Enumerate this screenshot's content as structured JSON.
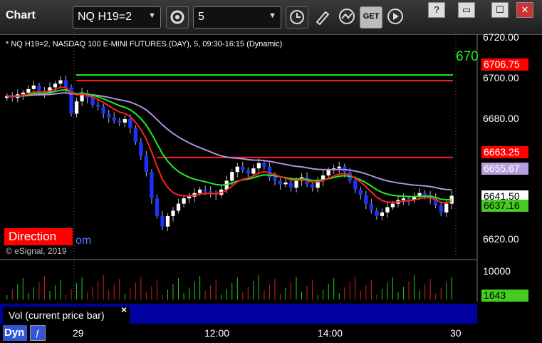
{
  "window": {
    "title": "Chart",
    "min": "?",
    "restore": "▭",
    "max": "☐",
    "close": "✕"
  },
  "toolbar": {
    "symbol": "NQ H19=2",
    "interval": "5",
    "get_label": "GET"
  },
  "legend": "* NQ H19=2, NASDAQ 100 E-MINI FUTURES (DAY), 5, 09:30-16:15 (Dynamic)",
  "direction_label": "Direction",
  "direction_suffix": "om",
  "copyright": "© eSignal, 2019",
  "cut_label": "670",
  "y_axis": {
    "ticks": [
      "6720.00",
      "6700.00",
      "6680.00",
      "6620.00"
    ],
    "tags": [
      {
        "text": "6706.75",
        "bg": "#ff0000",
        "fg": "#ffffff",
        "value": 6706.75
      },
      {
        "text": "6663.25",
        "bg": "#ff0000",
        "fg": "#ffffff",
        "value": 6663.25
      },
      {
        "text": "6655.67",
        "bg": "#b8a0e0",
        "fg": "#ffffff",
        "value": 6655.67
      },
      {
        "text": "6641.50",
        "bg": "#ffffff",
        "fg": "#000000",
        "value": 6641.5
      },
      {
        "text": "6637.16",
        "bg": "#44cc22",
        "fg": "#000000",
        "value": 6637.16
      }
    ]
  },
  "volume": {
    "label": "Vol (current price bar)",
    "tick": "10000",
    "current": "1643",
    "close_btn": "×"
  },
  "x_axis": {
    "labels": [
      "29",
      "12:00",
      "14:00",
      "30"
    ]
  },
  "dyn_label": "Dyn",
  "colors": {
    "up": "#ffffff",
    "down": "#1a33ff",
    "red": "#ff2020",
    "green": "#22ee22",
    "violet": "#b090e0",
    "grid": "#3a3a3a"
  },
  "chart_data": {
    "type": "candlestick",
    "ylim": [
      6615,
      6725
    ],
    "levels": [
      6706.75,
      6663.25
    ],
    "close": [
      6698,
      6697,
      6699,
      6700,
      6702,
      6704,
      6701,
      6700,
      6703,
      6705,
      6707,
      6703,
      6688,
      6695,
      6700,
      6697,
      6693,
      6692,
      6688,
      6686,
      6684,
      6683,
      6685,
      6680,
      6672,
      6664,
      6655,
      6640,
      6630,
      6624,
      6630,
      6633,
      6637,
      6640,
      6641,
      6643,
      6645,
      6644,
      6643,
      6642,
      6645,
      6650,
      6655,
      6658,
      6656,
      6654,
      6657,
      6660,
      6658,
      6652,
      6650,
      6648,
      6649,
      6646,
      6650,
      6652,
      6648,
      6646,
      6650,
      6653,
      6656,
      6657,
      6658,
      6655,
      6650,
      6645,
      6642,
      6637,
      6633,
      6630,
      6632,
      6635,
      6637,
      6639,
      6640,
      6639,
      6641,
      6643,
      6642,
      6640,
      6636,
      6632,
      6637,
      6641.5
    ]
  }
}
